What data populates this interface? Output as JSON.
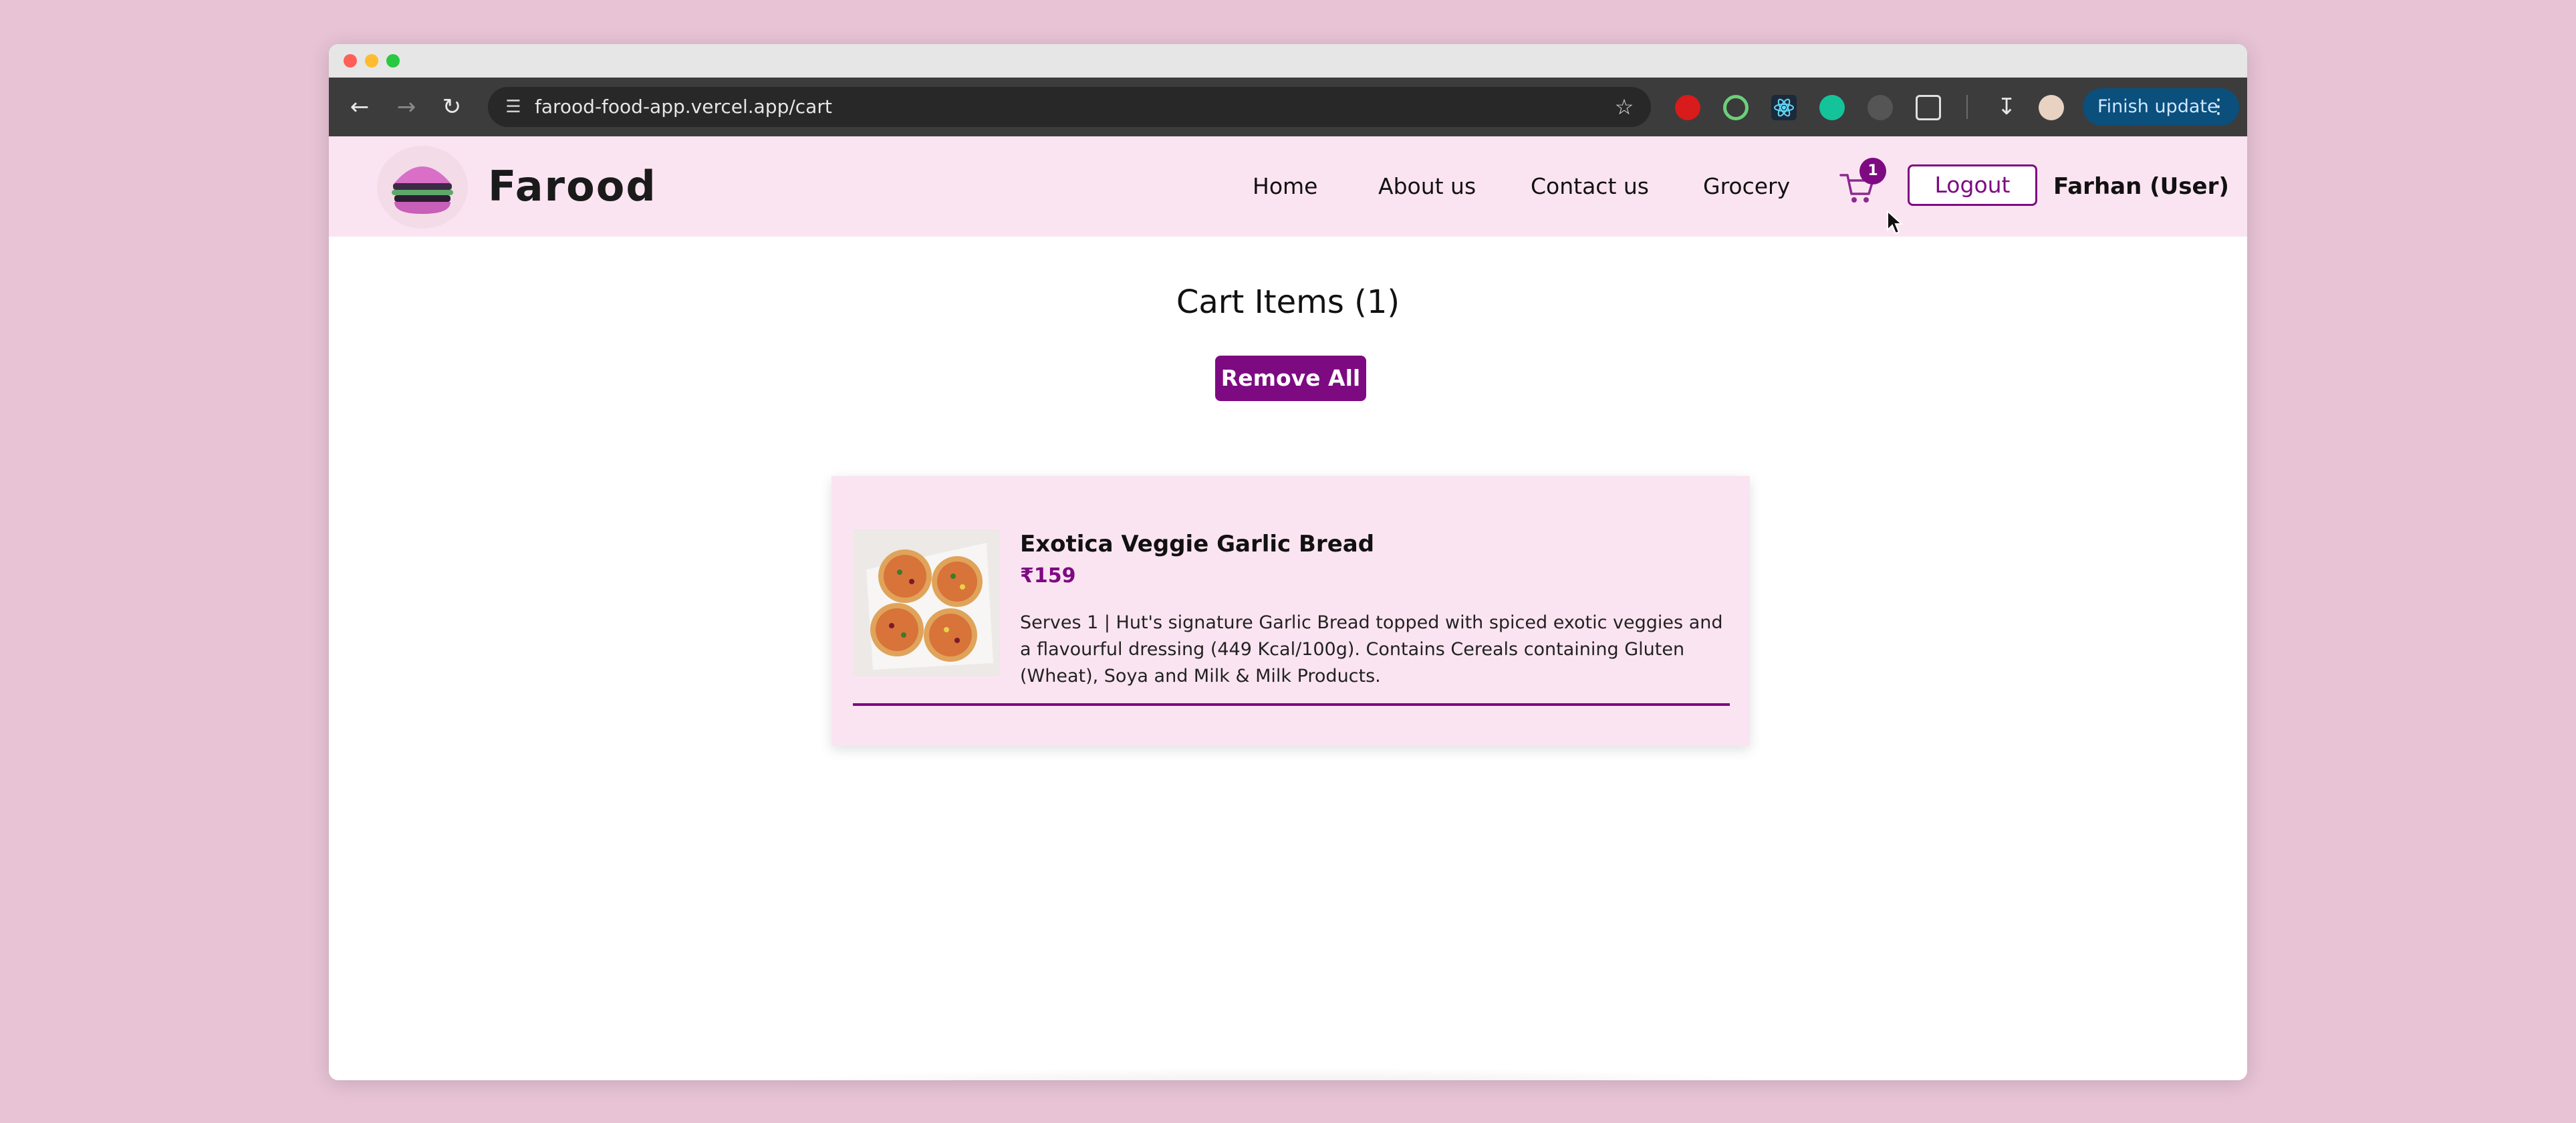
{
  "browser": {
    "url": "farood-food-app.vercel.app/cart",
    "update_label": "Finish update",
    "extensions": [
      "adblock-icon",
      "target-icon",
      "react-icon",
      "grammarly-icon",
      "bug-icon",
      "puzzle-icon"
    ]
  },
  "header": {
    "brand": "Farood",
    "nav": [
      "Home",
      "About us",
      "Contact us",
      "Grocery"
    ],
    "cart_count": "1",
    "logout_label": "Logout",
    "user": "Farhan (User)"
  },
  "cart": {
    "title": "Cart Items (1)",
    "remove_all_label": "Remove All",
    "items": [
      {
        "name": "Exotica Veggie Garlic Bread",
        "price": "₹159",
        "description": "Serves 1 | Hut's signature Garlic Bread topped with spiced exotic veggies and a flavourful dressing (449 Kcal/100g). Contains Cereals containing Gluten (Wheat), Soya and Milk & Milk Products."
      }
    ]
  },
  "colors": {
    "accent": "#7e0a82",
    "header_bg": "#fbe4f1",
    "page_bg": "#e7c3d5"
  }
}
